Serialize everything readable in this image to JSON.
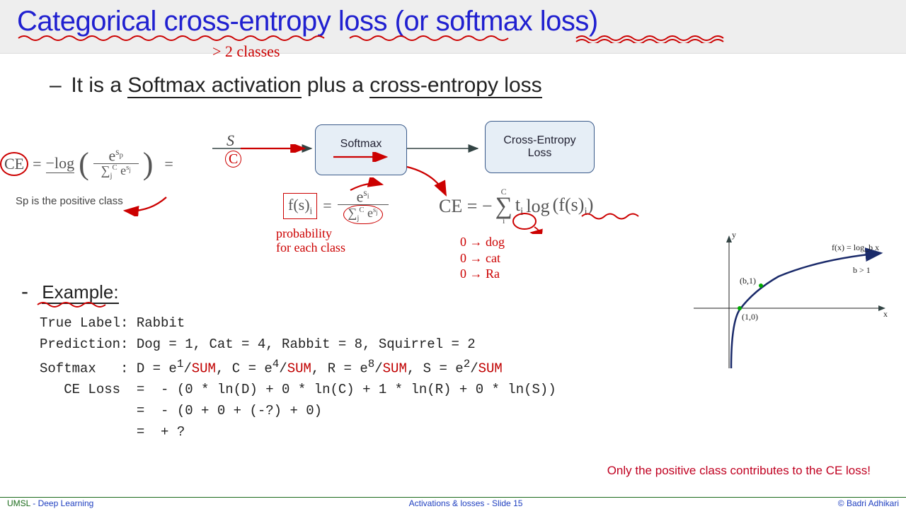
{
  "title": "Categorical cross-entropy loss (or softmax loss)",
  "annot_classes": "> 2 classes",
  "bullet": {
    "pre": "It is a ",
    "a": "Softmax activation",
    "mid": " plus a ",
    "b": "cross-entropy loss"
  },
  "flow": {
    "s_label": "S",
    "c_label": "C",
    "softmax": "Softmax",
    "celoss": "Cross-Entropy\nLoss"
  },
  "formula": {
    "ce_left": "CE",
    "eq": " = ",
    "neg_log": "−log",
    "frac_top": "e",
    "frac_top_exp": "s",
    "frac_top_sub": "p",
    "frac_bot_sum": "∑",
    "frac_bot_low": "j",
    "frac_bot_up": "C",
    "frac_bot_e": "e",
    "frac_bot_exp": "s",
    "frac_bot_exp_sub": "j",
    "sp_note": "Sp is the positive class",
    "fs": "f(s)",
    "i": "i",
    "probnote1": "probability",
    "probnote2": "for each class",
    "ce2": "CE = −",
    "sum": "∑",
    "sum_low": "i",
    "sum_up": "C",
    "ti": "t",
    "log": "log",
    "fsi": "(f(s)",
    "close": ")",
    "dog": "0 → dog",
    "cat": "0 → cat",
    "rab": "0 → Ra"
  },
  "log_graph": {
    "y": "y",
    "x": "x",
    "fx": "f(x) = log_b x",
    "bgt": "b > 1",
    "b1": "(b,1)",
    "one0": "(1,0)"
  },
  "example": {
    "head": "Example:",
    "l1": "True Label: Rabbit",
    "l2": "Prediction: Dog = 1, Cat = 4, Rabbit = 8, Squirrel = 2",
    "l3a": "Softmax   : D = e",
    "l3b": "/",
    "l3c": "SUM",
    "l3d": ", C = e",
    "l3e": "/",
    "l3f": "SUM",
    "l3g": ", R = e",
    "l3h": "/",
    "l3i": "SUM",
    "l3j": ", S = e",
    "l3k": "/",
    "l3l": "SUM",
    "exp1": "1",
    "exp4": "4",
    "exp8": "8",
    "exp2": "2",
    "l4": "   CE Loss  =  - (0 * ln(D) + 0 * ln(C) + 1 * ln(R) + 0 * ln(S))",
    "l5": "            =  - (0 + 0 + (-?) + 0)",
    "l6": "            =  + ?"
  },
  "footnote": "Only the positive class contributes to the CE loss!",
  "footer": {
    "left_a": "UMSL",
    "left_b": " - ",
    "left_c": "Deep Learning",
    "mid": "Activations & losses -  Slide  15",
    "right": "© Badri Adhikari"
  }
}
